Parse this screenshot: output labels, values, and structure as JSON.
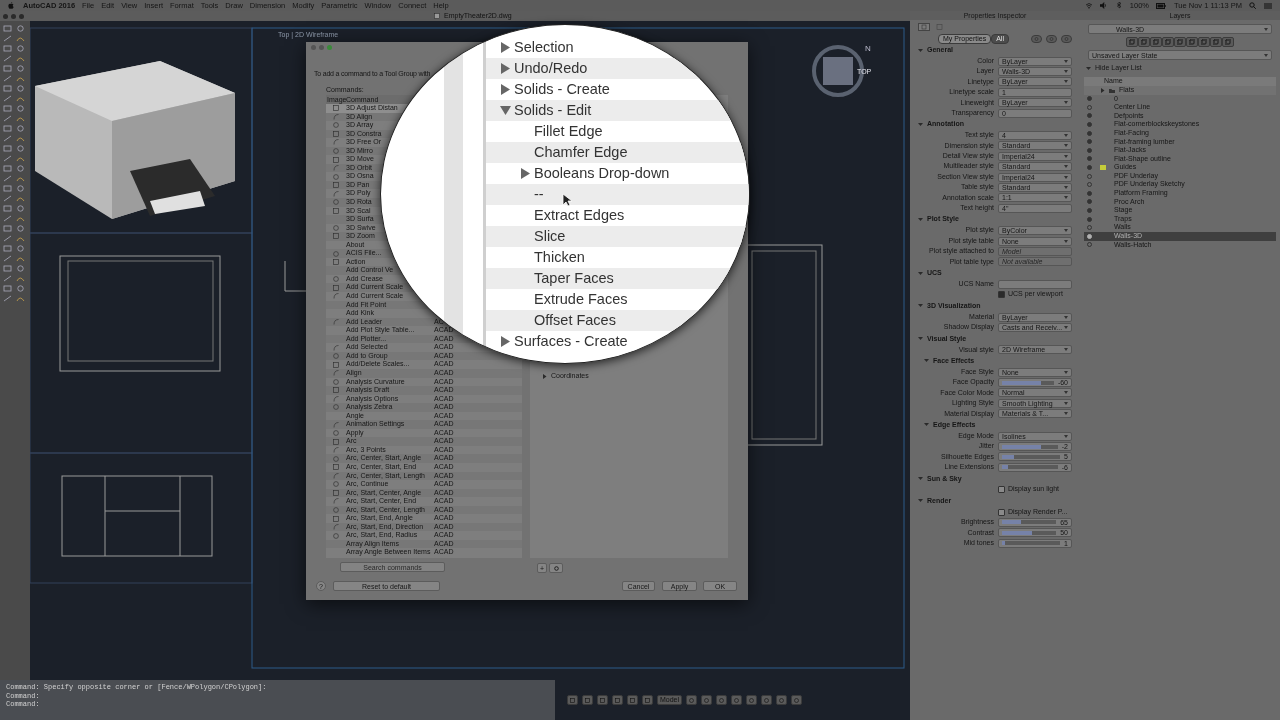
{
  "menubar": {
    "app": "AutoCAD 2016",
    "menus": [
      "File",
      "Edit",
      "View",
      "Insert",
      "Format",
      "Tools",
      "Draw",
      "Dimension",
      "Modify",
      "Parametric",
      "Window",
      "Connect",
      "Help"
    ],
    "battery": "100%",
    "clock": "Tue Nov 1  11:13 PM"
  },
  "document": {
    "title": "EmptyTheater2D.dwg",
    "viewport_label": "Top | 2D Wireframe",
    "viewcube_face": "TOP",
    "compass": "N"
  },
  "dialog": {
    "instruction": "To add a command to a Tool Group with",
    "commands_label": "Commands:",
    "columns": [
      "Image",
      "Command"
    ],
    "commands": [
      {
        "name": "3D Adjust Distan",
        "icon": true,
        "selected": true
      },
      {
        "name": "3D Align",
        "icon": true,
        "selected": false
      },
      {
        "name": "3D Array",
        "icon": true,
        "selected": false
      },
      {
        "name": "3D Constra",
        "icon": true,
        "selected": false
      },
      {
        "name": "3D Free Or",
        "icon": true,
        "selected": false
      },
      {
        "name": "3D Mirro",
        "icon": true,
        "selected": false
      },
      {
        "name": "3D Move",
        "icon": true,
        "selected": false
      },
      {
        "name": "3D Orbit",
        "icon": true,
        "selected": false
      },
      {
        "name": "3D Osna",
        "icon": true,
        "selected": false
      },
      {
        "name": "3D Pan",
        "icon": true,
        "selected": false
      },
      {
        "name": "3D Poly",
        "icon": true,
        "selected": false
      },
      {
        "name": "3D Rota",
        "icon": true,
        "selected": false
      },
      {
        "name": "3D Scal",
        "icon": true,
        "selected": false
      },
      {
        "name": "3D Surfa",
        "icon": false,
        "selected": false
      },
      {
        "name": "3D Swive",
        "icon": true,
        "selected": false
      },
      {
        "name": "3D Zoom",
        "icon": true,
        "selected": false
      },
      {
        "name": "About",
        "icon": false,
        "selected": false
      },
      {
        "name": "ACIS File...",
        "icon": true,
        "selected": false
      },
      {
        "name": "Action",
        "icon": true,
        "selected": false
      },
      {
        "name": "Add Control Ve",
        "icon": false,
        "selected": false
      },
      {
        "name": "Add Crease",
        "icon": true,
        "selected": false
      },
      {
        "name": "Add Current Scale",
        "icon": true,
        "selected": false
      },
      {
        "name": "Add Current Scale",
        "icon": true,
        "selected": false
      },
      {
        "name": "Add Fit Point",
        "icon": false,
        "selected": false
      },
      {
        "name": "Add Kink",
        "icon": false,
        "selected": false
      },
      {
        "name": "Add Leader",
        "icon": true,
        "selected": false,
        "source": "AC"
      },
      {
        "name": "Add Plot Style Table...",
        "icon": false,
        "selected": false,
        "source": "ACAD"
      },
      {
        "name": "Add Plotter...",
        "icon": false,
        "selected": false,
        "source": "ACAD"
      },
      {
        "name": "Add Selected",
        "icon": true,
        "selected": false,
        "source": "ACAD"
      },
      {
        "name": "Add to Group",
        "icon": true,
        "selected": false,
        "source": "ACAD"
      },
      {
        "name": "Add/Delete Scales...",
        "icon": true,
        "selected": false,
        "source": "ACAD"
      },
      {
        "name": "Align",
        "icon": true,
        "selected": false,
        "source": "ACAD"
      },
      {
        "name": "Analysis Curvature",
        "icon": true,
        "selected": false,
        "source": "ACAD"
      },
      {
        "name": "Analysis Draft",
        "icon": true,
        "selected": false,
        "source": "ACAD"
      },
      {
        "name": "Analysis Options",
        "icon": true,
        "selected": false,
        "source": "ACAD"
      },
      {
        "name": "Analysis Zebra",
        "icon": true,
        "selected": false,
        "source": "ACAD"
      },
      {
        "name": "Angle",
        "icon": false,
        "selected": false,
        "source": "ACAD"
      },
      {
        "name": "Animation Settings",
        "icon": true,
        "selected": false,
        "source": "ACAD"
      },
      {
        "name": "Apply",
        "icon": true,
        "selected": false,
        "source": "ACAD"
      },
      {
        "name": "Arc",
        "icon": true,
        "selected": false,
        "source": "ACAD"
      },
      {
        "name": "Arc, 3 Points",
        "icon": true,
        "selected": false,
        "source": "ACAD"
      },
      {
        "name": "Arc, Center, Start, Angle",
        "icon": true,
        "selected": false,
        "source": "ACAD"
      },
      {
        "name": "Arc, Center, Start, End",
        "icon": true,
        "selected": false,
        "source": "ACAD"
      },
      {
        "name": "Arc, Center, Start, Length",
        "icon": true,
        "selected": false,
        "source": "ACAD"
      },
      {
        "name": "Arc, Continue",
        "icon": true,
        "selected": false,
        "source": "ACAD"
      },
      {
        "name": "Arc, Start, Center, Angle",
        "icon": true,
        "selected": false,
        "source": "ACAD"
      },
      {
        "name": "Arc, Start, Center, End",
        "icon": true,
        "selected": false,
        "source": "ACAD"
      },
      {
        "name": "Arc, Start, Center, Length",
        "icon": true,
        "selected": false,
        "source": "ACAD"
      },
      {
        "name": "Arc, Start, End, Angle",
        "icon": true,
        "selected": false,
        "source": "ACAD"
      },
      {
        "name": "Arc, Start, End, Direction",
        "icon": true,
        "selected": false,
        "source": "ACAD"
      },
      {
        "name": "Arc, Start, End, Radius",
        "icon": true,
        "selected": false,
        "source": "ACAD"
      },
      {
        "name": "Array Align Items",
        "icon": false,
        "selected": false,
        "source": "ACAD"
      },
      {
        "name": "Array Angle Between Items",
        "icon": false,
        "selected": false,
        "source": "ACAD"
      }
    ],
    "search_placeholder": "Search commands",
    "tool_item": {
      "label": "Coordinates",
      "expanded": false
    },
    "help": "?",
    "reset": "Reset to default",
    "add": "+",
    "buttons": [
      "Cancel",
      "Apply",
      "OK"
    ]
  },
  "magnifier": {
    "tree": [
      {
        "label": "Selection",
        "expanded": false
      },
      {
        "label": "Undo/Redo",
        "expanded": false
      },
      {
        "label": "Solids - Create",
        "expanded": false
      },
      {
        "label": "Solids - Edit",
        "expanded": true,
        "children": [
          {
            "label": "Fillet Edge"
          },
          {
            "label": "Chamfer Edge"
          },
          {
            "label": "Booleans Drop-down",
            "expanded": false
          },
          {
            "label": "--"
          },
          {
            "label": "Extract Edges"
          },
          {
            "label": "Slice"
          },
          {
            "label": "Thicken"
          },
          {
            "label": "Taper Faces"
          },
          {
            "label": "Extrude Faces"
          },
          {
            "label": "Offset Faces"
          }
        ]
      },
      {
        "label": "Surfaces - Create",
        "expanded": false
      }
    ]
  },
  "properties": {
    "title": "Properties Inspector",
    "filters": [
      {
        "label": "My Properties",
        "selected": false
      },
      {
        "label": "All",
        "selected": true
      }
    ],
    "sections": [
      {
        "title": "General",
        "rows": [
          {
            "kind": "dropdown",
            "label": "Color",
            "value": "ByLayer"
          },
          {
            "kind": "dropdown",
            "label": "Layer",
            "value": "Walls-3D"
          },
          {
            "kind": "dropdown",
            "label": "Linetype",
            "value": "ByLayer"
          },
          {
            "kind": "text",
            "label": "Linetype scale",
            "value": "1"
          },
          {
            "kind": "dropdown",
            "label": "Lineweight",
            "value": "ByLayer"
          },
          {
            "kind": "text",
            "label": "Transparency",
            "value": "0"
          }
        ]
      },
      {
        "title": "Annotation",
        "rows": [
          {
            "kind": "dropdown",
            "label": "Text style",
            "value": "4"
          },
          {
            "kind": "dropdown",
            "label": "Dimension style",
            "value": "Standard"
          },
          {
            "kind": "dropdown",
            "label": "Detail View style",
            "value": "Imperial24"
          },
          {
            "kind": "dropdown",
            "label": "Multileader style",
            "value": "Standard"
          },
          {
            "kind": "dropdown",
            "label": "Section View style",
            "value": "Imperial24"
          },
          {
            "kind": "dropdown",
            "label": "Table style",
            "value": "Standard"
          },
          {
            "kind": "dropdown",
            "label": "Annotation scale",
            "value": "1:1"
          },
          {
            "kind": "text",
            "label": "Text height",
            "value": "4\""
          }
        ]
      },
      {
        "title": "Plot Style",
        "rows": [
          {
            "kind": "dropdown",
            "label": "Plot style",
            "value": "ByColor"
          },
          {
            "kind": "dropdown",
            "label": "Plot style table",
            "value": "None"
          },
          {
            "kind": "text",
            "label": "Plot style attached to",
            "value": "Model",
            "disabled": true
          },
          {
            "kind": "text",
            "label": "Plot table type",
            "value": "Not available",
            "disabled": true
          }
        ]
      },
      {
        "title": "UCS",
        "rows": [
          {
            "kind": "text",
            "label": "UCS Name"
          },
          {
            "kind": "checkbox",
            "label": "UCS per viewport",
            "checked": true
          }
        ]
      },
      {
        "title": "3D Visualization",
        "rows": [
          {
            "kind": "dropdown",
            "label": "Material",
            "value": "ByLayer"
          },
          {
            "kind": "dropdown",
            "label": "Shadow Display",
            "value": "Casts and Receiv..."
          }
        ]
      },
      {
        "title": "Visual Style",
        "rows": [
          {
            "kind": "dropdown",
            "label": "Visual style",
            "value": "2D Wireframe"
          },
          {
            "kind": "subheader",
            "label": "Face Effects"
          },
          {
            "kind": "dropdown",
            "label": "Face Style",
            "value": "None"
          },
          {
            "kind": "slider",
            "label": "Face Opacity",
            "value": "-60",
            "level": 0.75
          },
          {
            "kind": "dropdown",
            "label": "Face Color Mode",
            "value": "Normal"
          },
          {
            "kind": "dropdown",
            "label": "Lighting Style",
            "value": "Smooth Lighting"
          },
          {
            "kind": "dropdown",
            "label": "Material Display",
            "value": "Materials & T..."
          },
          {
            "kind": "subheader",
            "label": "Edge Effects"
          },
          {
            "kind": "dropdown",
            "label": "Edge Mode",
            "value": "Isolines"
          },
          {
            "kind": "slider",
            "label": "Jitter",
            "value": "-2",
            "level": 0.7
          },
          {
            "kind": "slider",
            "label": "Silhouette Edges",
            "value": "5",
            "level": 0.2
          },
          {
            "kind": "slider",
            "label": "Line Extensions",
            "value": "-6",
            "level": 0.1
          }
        ]
      },
      {
        "title": "Sun & Sky",
        "rows": [
          {
            "kind": "checkbox",
            "label": "Display sun light",
            "checked": false
          }
        ]
      },
      {
        "title": "Render",
        "rows": [
          {
            "kind": "checkbox",
            "label": "Display Render P...",
            "checked": false
          },
          {
            "kind": "slider",
            "label": "Brightness",
            "value": "65",
            "level": 0.35
          },
          {
            "kind": "slider",
            "label": "Contrast",
            "value": "50",
            "level": 0.55
          },
          {
            "kind": "slider",
            "label": "Mid tones",
            "value": "1",
            "level": 0.05
          }
        ]
      }
    ]
  },
  "layers": {
    "title": "Layers",
    "current": "Walls-3D",
    "state": "Unsaved Layer State",
    "hide_list": "Hide Layer List",
    "name_column": "Name",
    "group": "Flats",
    "items": [
      {
        "name": "0",
        "on": true,
        "selected": false
      },
      {
        "name": "Center Line",
        "on": false,
        "selected": false
      },
      {
        "name": "Defpoints",
        "on": true,
        "selected": false
      },
      {
        "name": "Flat-cornerblockskeystones",
        "on": true,
        "selected": false
      },
      {
        "name": "Flat-Facing",
        "on": true,
        "selected": false
      },
      {
        "name": "Flat-framing lumber",
        "on": true,
        "selected": false
      },
      {
        "name": "Flat-Jacks",
        "on": true,
        "selected": false
      },
      {
        "name": "Flat-Shape outline",
        "on": true,
        "selected": false
      },
      {
        "name": "Guides",
        "on": true,
        "selected": false,
        "color": "#c4cc3a"
      },
      {
        "name": "PDF Underlay",
        "on": false,
        "selected": false
      },
      {
        "name": "PDF Underlay Sketchy",
        "on": false,
        "selected": false
      },
      {
        "name": "Platform Framing",
        "on": true,
        "selected": false
      },
      {
        "name": "Proc Arch",
        "on": true,
        "selected": false
      },
      {
        "name": "Stage",
        "on": true,
        "selected": false
      },
      {
        "name": "Traps",
        "on": true,
        "selected": false
      },
      {
        "name": "Walls",
        "on": false,
        "selected": false
      },
      {
        "name": "Walls-3D",
        "on": true,
        "selected": true
      },
      {
        "name": "Walls-Hatch",
        "on": false,
        "selected": false
      }
    ]
  },
  "command_line": [
    "Command: Specify opposite corner or [Fence/WPolygon/CPolygon]:",
    "Command:",
    "Command:"
  ],
  "status_bar": {
    "model": "Model"
  }
}
